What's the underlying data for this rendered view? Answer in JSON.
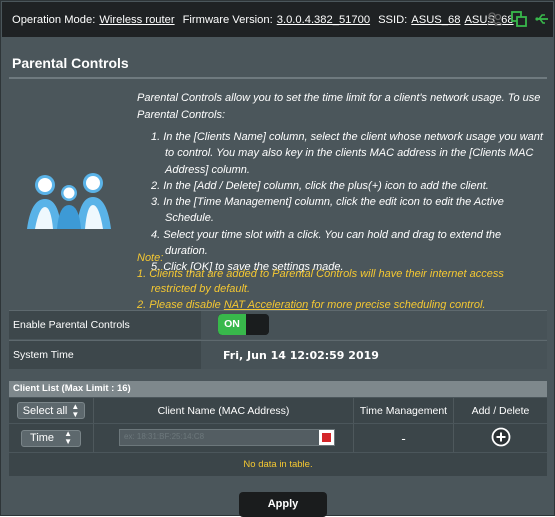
{
  "statusbar": {
    "operation_mode_label": "Operation Mode:",
    "operation_mode": "Wireless router",
    "firmware_label": "Firmware Version:",
    "firmware": "3.0.0.4.382_51700",
    "ssid_label": "SSID:",
    "ssid_1": "ASUS_68",
    "ssid_2": "ASUS_68",
    "icons": [
      "users-icon",
      "network-icon",
      "usb-icon"
    ]
  },
  "page": {
    "title": "Parental Controls",
    "intro": "Parental Controls allow you to set the time limit for a client's network usage. To use Parental Controls:",
    "steps": [
      "1. In the [Clients Name] column, select the client whose network usage you want to control. You may also key in the clients MAC address in the [Clients MAC Address] column.",
      "2. In the [Add / Delete] column, click the plus(+) icon to add the client.",
      "3. In the [Time Management] column, click the edit icon to edit the Active Schedule.",
      "4. Select your time slot with a click. You can hold and drag to extend the duration.",
      "5. Click [OK] to save the settings made."
    ],
    "note_label": "Note:",
    "note_1": "1. Clients that are added to Parental Controls will have their internet access restricted by default.",
    "note_2_prefix": "2. Please disable ",
    "note_2_link": "NAT Acceleration",
    "note_2_suffix": " for more precise scheduling control."
  },
  "settings": {
    "enable_label": "Enable Parental Controls",
    "enable_value": "ON",
    "time_label": "System Time",
    "time_value": "Fri, Jun 14 12:02:59 2019"
  },
  "client_list": {
    "header": "Client List (Max Limit : 16)",
    "select_all": "Select all",
    "col_name": "Client Name (MAC Address)",
    "col_time": "Time Management",
    "col_add": "Add / Delete",
    "time_select": "Time",
    "client_placeholder": "ex: 18:31:BF:25:14:C8",
    "time_dash": "-",
    "no_data": "No data in table."
  },
  "apply_label": "Apply",
  "colors": {
    "accent_on": "#38b84b",
    "note": "#f5c832",
    "bg": "#4b565b"
  }
}
